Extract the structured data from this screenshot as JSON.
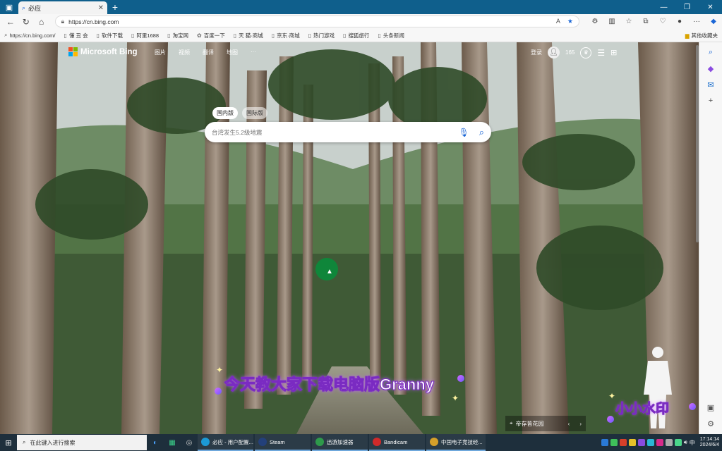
{
  "tab": {
    "title": "必应"
  },
  "omnibox": {
    "url": "https://cn.bing.com"
  },
  "bookmarks": {
    "items": [
      "https://cn.bing.com/",
      "懂 丑 会",
      "软件下载",
      "阿里1688",
      "淘宝网",
      "百度一下",
      "天 猫·商城",
      "京东·商城",
      "热门游戏",
      "搜狐旅行",
      "头条新闻"
    ],
    "other": "其他收藏夹"
  },
  "bing": {
    "logo_text": "Microsoft Bing",
    "nav": [
      "图片",
      "视频",
      "翻译",
      "地图",
      "···"
    ],
    "signin": "登录",
    "points": "165",
    "scope_cn": "国内版",
    "scope_intl": "国际版",
    "search_placeholder": "台湾发生5.2级地震",
    "location": "帝存皆花园"
  },
  "overlay": {
    "subtitle": "今天教大家下载电脑版Granny",
    "watermark": "小小水印"
  },
  "taskbar": {
    "search_placeholder": "在此键入进行搜索",
    "apps": [
      "必应 - 用户配置...",
      "Steam",
      "迅游加速器",
      "Bandicam",
      "中国电子竞技经..."
    ],
    "time": "17:14:14",
    "date": "2024/6/4"
  },
  "colors": {
    "tabbar": "#0f5f8c",
    "accent": "#1a66d6",
    "subtitle_stroke": "#7a2bc2"
  }
}
